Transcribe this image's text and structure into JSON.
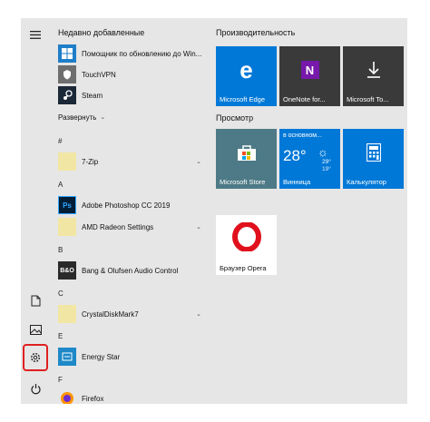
{
  "list": {
    "recent_heading": "Недавно добавленные",
    "recent": [
      {
        "label": "Помощник по обновлению до Win..."
      },
      {
        "label": "TouchVPN"
      },
      {
        "label": "Steam"
      }
    ],
    "expand_label": "Развернуть",
    "sections": [
      {
        "letter": "#",
        "apps": [
          {
            "label": "7-Zip",
            "expandable": true
          }
        ]
      },
      {
        "letter": "A",
        "apps": [
          {
            "label": "Adobe Photoshop CC 2019"
          },
          {
            "label": "AMD Radeon Settings",
            "expandable": true
          }
        ]
      },
      {
        "letter": "B",
        "apps": [
          {
            "label": "Bang & Olufsen Audio Control"
          }
        ]
      },
      {
        "letter": "C",
        "apps": [
          {
            "label": "CrystalDiskMark7",
            "expandable": true
          }
        ]
      },
      {
        "letter": "E",
        "apps": [
          {
            "label": "Energy Star"
          }
        ]
      },
      {
        "letter": "F",
        "apps": [
          {
            "label": "Firefox"
          }
        ]
      }
    ]
  },
  "tiles": {
    "group1_title": "Производительность",
    "group2_title": "Просмотр",
    "edge": {
      "label": "Microsoft Edge",
      "color": "#0078d7"
    },
    "onenote": {
      "label": "OneNote for...",
      "color": "#3a3a3a"
    },
    "todo": {
      "label": "Microsoft To...",
      "color": "#3a3a3a"
    },
    "store": {
      "label": "Microsoft Store",
      "color": "#4d7a86"
    },
    "weather": {
      "label_city": "Винница",
      "region": "в основном...",
      "temperature": "28°",
      "high": "29°",
      "low": "19°",
      "color": "#0078d7"
    },
    "calc": {
      "label": "Калькулятор",
      "color": "#0078d7"
    },
    "opera": {
      "label": "Браузер Opera",
      "color": "#ffffff"
    }
  }
}
